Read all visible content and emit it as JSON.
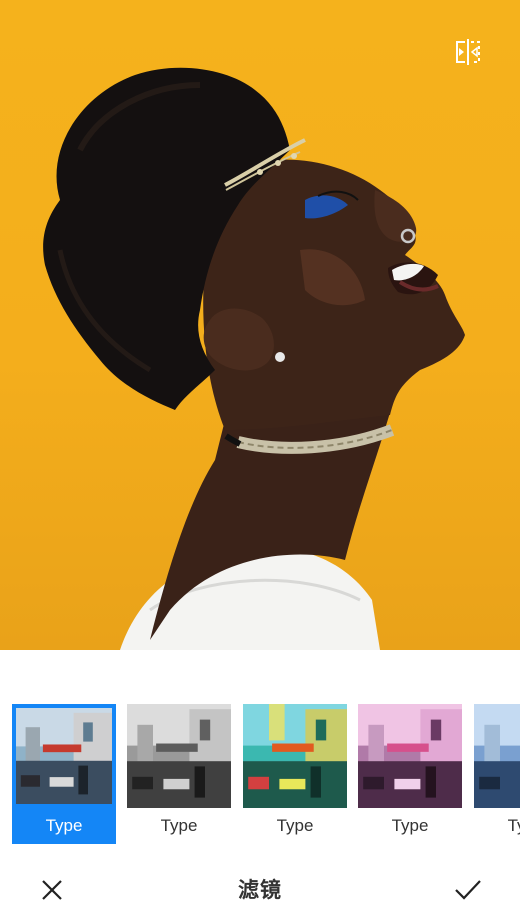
{
  "preview": {
    "compare_icon": "compare-split-icon"
  },
  "filters": {
    "items": [
      {
        "label": "Type",
        "selected": true
      },
      {
        "label": "Type",
        "selected": false
      },
      {
        "label": "Type",
        "selected": false
      },
      {
        "label": "Type",
        "selected": false
      },
      {
        "label": "Type",
        "selected": false
      }
    ]
  },
  "bottom_bar": {
    "title": "滤镜",
    "cancel_icon": "close-icon",
    "confirm_icon": "check-icon"
  },
  "colors": {
    "accent": "#1486f6",
    "photo_background": "#f5b21c"
  }
}
